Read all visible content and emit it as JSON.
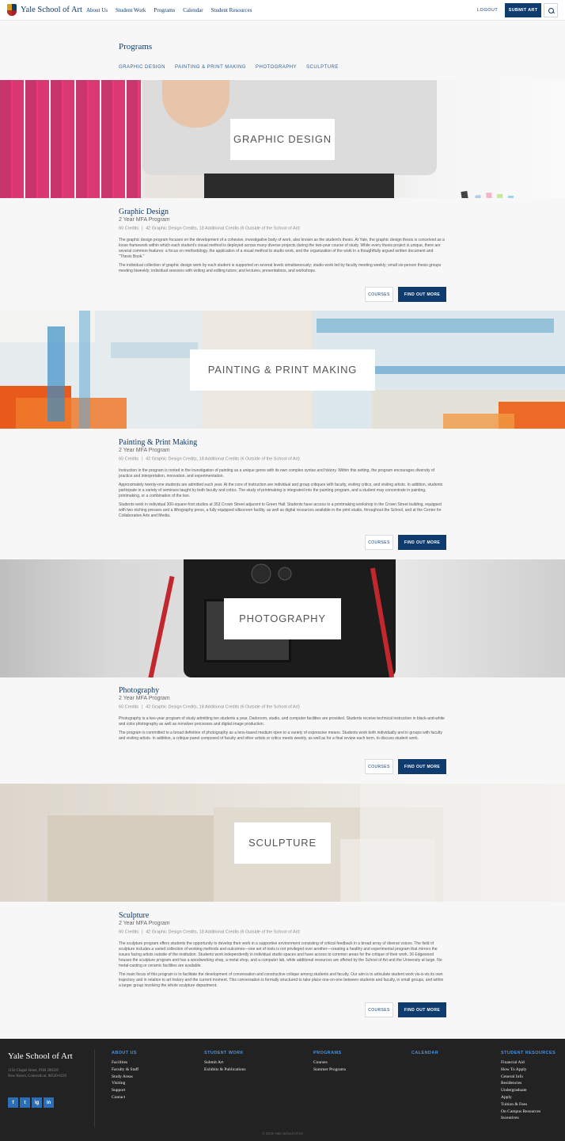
{
  "header": {
    "logo_text": "Yale School of Art",
    "nav": [
      "About Us",
      "Student Work",
      "Programs",
      "Calendar",
      "Student Resources"
    ],
    "logout": "LOGOUT",
    "submit_art": "SUBMIT ART"
  },
  "page": {
    "title": "Programs",
    "subnav": [
      "GRAPHIC DESIGN",
      "PAINTING & PRINT MAKING",
      "PHOTOGRAPHY",
      "SCULPTURE"
    ]
  },
  "programs": [
    {
      "hero_label": "GRAPHIC DESIGN",
      "title": "Graphic Design",
      "subtitle": "2 Year MFA Program",
      "credits": "60 Credits",
      "credits_detail": "42 Graphic Design Credits, 18 Additional Credits (6 Outside of the School of Art)",
      "paragraphs": [
        "The graphic design program focuses on the development of a cohesive, investigative body of work, also known as the student's thesis. At Yale, the graphic design thesis is conceived as a loose framework within which each student's visual method is deployed across many diverse projects during the two-year course of study. While every thesis project is unique, there are several common features: a focus on methodology, the application of a visual method to studio work, and the organization of the work in a thoughtfully argued written document and \"Thesis Book.\"",
        "The individual collection of graphic design work by each student is supported on several levels simultaneously; studio work led by faculty meeting weekly; small six-person thesis groups meeting biweekly; individual sessions with writing and editing tutors; and lectures, presentations, and workshops."
      ],
      "courses_label": "COURSES",
      "more_label": "FIND OUT MORE"
    },
    {
      "hero_label": "PAINTING & PRINT MAKING",
      "title": "Painting & Print Making",
      "subtitle": "2 Year MFA Program",
      "credits": "60 Credits",
      "credits_detail": "42 Graphic Design Credits, 18 Additional Credits (6 Outside of the School of Art)",
      "paragraphs": [
        "Instruction in the program is rooted in the investigation of painting as a unique genre with its own complex syntax and history. Within this setting, the program encourages diversity of practice and interpretation, innovation, and experimentation.",
        "Approximately twenty-one students are admitted each year. At the core of instruction are individual and group critiques with faculty, visiting critics, and visiting artists. In addition, students participate in a variety of seminars taught by both faculty and critics. The study of printmaking is integrated into the painting program, and a student may concentrate in painting, printmaking, or a combination of the two.",
        "Students work in individual 300-square-foot studios at 353 Crown Street adjacent to Green Hall. Students have access to a printmaking workshop in the Crown Street building, equipped with two etching presses and a lithography press, a fully equipped silkscreen facility, as well as digital resources available in the print studio, throughout the School, and at the Center for Collaborative Arts and Media."
      ],
      "courses_label": "COURSES",
      "more_label": "FIND OUT MORE"
    },
    {
      "hero_label": "PHOTOGRAPHY",
      "title": "Photography",
      "subtitle": "2 Year MFA Program",
      "credits": "60 Credits",
      "credits_detail": "42 Graphic Design Credits, 18 Additional Credits (6 Outside of the School of Art)",
      "paragraphs": [
        "Photography is a two-year program of study admitting ten students a year. Darkroom, studio, and computer facilities are provided. Students receive technical instruction in black-and-white and color photography as well as nonsilver processes and digital image production.",
        "The program is committed to a broad definition of photography as a lens-based medium open to a variety of expressive means. Students work both individually and in groups with faculty and visiting artists. In addition, a critique panel composed of faculty and other artists or critics meets weekly, as well as for a final review each term, to discuss student work."
      ],
      "courses_label": "COURSES",
      "more_label": "FIND OUT MORE"
    },
    {
      "hero_label": "SCULPTURE",
      "title": "Sculpture",
      "subtitle": "2 Year MFA Program",
      "credits": "60 Credits",
      "credits_detail": "42 Graphic Design Credits, 18 Additional Credits (6 Outside of the School of Art)",
      "paragraphs": [
        "The sculpture program offers students the opportunity to develop their work in a supportive environment consisting of critical feedback in a broad array of diverse voices. The field of sculpture includes a varied collection of working methods and outcomes—one set of tools is not privileged over another—creating a healthy and experimental program that mirrors the issues facing artists outside of the institution. Students work independently in individual studio spaces and have access to common areas for the critique of their work. 36 Edgewood houses the sculpture program and has a woodworking shop, a metal shop, and a computer lab, while additional resources are offered by the School of Art and the University at large. No metal-casting or ceramic facilities are available.",
        "The main focus of this program is to facilitate the development of conversation and constructive critique among students and faculty. Our aim is to articulate student work vis-à-vis its own trajectory and in relation to art history and the current moment. This conversation is formally structured to take place one-on-one between students and faculty, in small groups, and within a larger group involving the whole sculpture department."
      ],
      "courses_label": "COURSES",
      "more_label": "FIND OUT MORE"
    }
  ],
  "footer": {
    "logo_text": "Yale School of Art",
    "address_line1": "1156 Chapel Street, POB 208339",
    "address_line2": "New Haven, Connecticut, 06520-8339",
    "social": [
      "f",
      "t",
      "ig",
      "in"
    ],
    "columns": [
      {
        "heading": "ABOUT US",
        "links": [
          "Facilities",
          "Faculty & Staff",
          "Study Areas",
          "Visiting",
          "Support",
          "Contact"
        ]
      },
      {
        "heading": "STUDENT WORK",
        "links": [
          "Submit Art",
          "Exhibits & Publications"
        ]
      },
      {
        "heading": "PROGRAMS",
        "links": [
          "Courses",
          "Summer Programs"
        ]
      },
      {
        "heading": "CALENDAR",
        "links": []
      },
      {
        "heading": "STUDENT RESOURCES",
        "links": [
          "Financial Aid",
          "How To Apply",
          "General Info",
          "Residencies",
          "Undergraduate",
          "Apply",
          "Tuition & Fees",
          "On Campus Resources",
          "Incentives"
        ]
      }
    ],
    "copyright": "© 2019 Yale School of Art"
  },
  "colors": {
    "brand_blue": "#0f3b6e",
    "link_blue": "#2c5f9a",
    "footer_bg": "#222222",
    "footer_heading": "#4a90d9"
  }
}
